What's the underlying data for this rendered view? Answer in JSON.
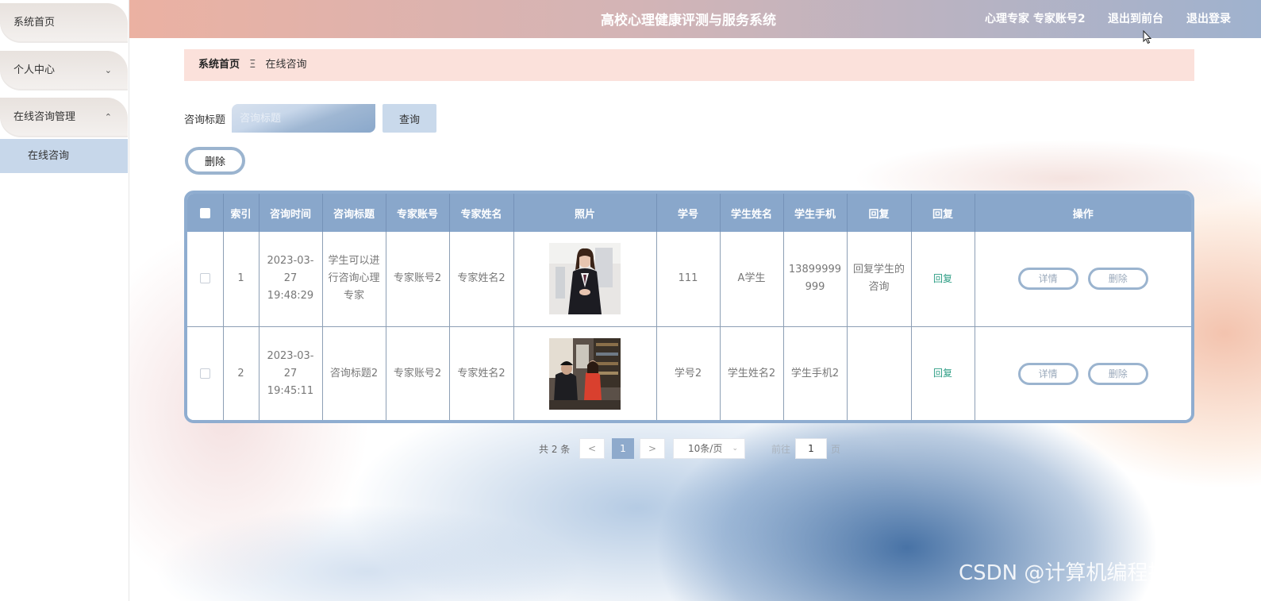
{
  "header": {
    "title": "高校心理健康评测与服务系统",
    "user": "心理专家 专家账号2",
    "front_link": "退出到前台",
    "logout_link": "退出登录"
  },
  "sidebar": {
    "items": [
      {
        "label": "系统首页"
      },
      {
        "label": "个人中心",
        "chevron": "⌄"
      },
      {
        "label": "在线咨询管理",
        "chevron": "⌃"
      }
    ],
    "sub_item": "在线咨询"
  },
  "breadcrumb": {
    "home": "系统首页",
    "separator": "Ξ",
    "current": "在线咨询"
  },
  "search": {
    "label": "咨询标题",
    "placeholder": "咨询标题",
    "button": "查询"
  },
  "toolbar": {
    "delete_label": "删除"
  },
  "table": {
    "headers": [
      "",
      "索引",
      "咨询时间",
      "咨询标题",
      "专家账号",
      "专家姓名",
      "照片",
      "学号",
      "学生姓名",
      "学生手机",
      "回复",
      "回复",
      "操作"
    ],
    "rows": [
      {
        "index": "1",
        "time": "2023-03-27 19:48:29",
        "title": "学生可以进行咨询心理专家",
        "expert_account": "专家账号2",
        "expert_name": "专家姓名2",
        "student_id": "111",
        "student_name": "A学生",
        "student_phone": "13899999999",
        "reply_text": "回复学生的咨询",
        "reply_link": "回复",
        "detail_btn": "详情",
        "delete_btn": "删除"
      },
      {
        "index": "2",
        "time": "2023-03-27 19:45:11",
        "title": "咨询标题2",
        "expert_account": "专家账号2",
        "expert_name": "专家姓名2",
        "student_id": "学号2",
        "student_name": "学生姓名2",
        "student_phone": "学生手机2",
        "reply_text": "",
        "reply_link": "回复",
        "detail_btn": "详情",
        "delete_btn": "删除"
      }
    ]
  },
  "pagination": {
    "total": "共 2 条",
    "prev": "<",
    "current": "1",
    "next": ">",
    "page_size": "10条/页",
    "goto_label": "前往",
    "goto_value": "1",
    "page_suffix": "页"
  },
  "watermark": "CSDN @计算机编程指导师",
  "colors": {
    "accent": "#89a7cb",
    "breadcrumb_bg": "#fbe1db",
    "reply_link": "#2e9e85"
  }
}
